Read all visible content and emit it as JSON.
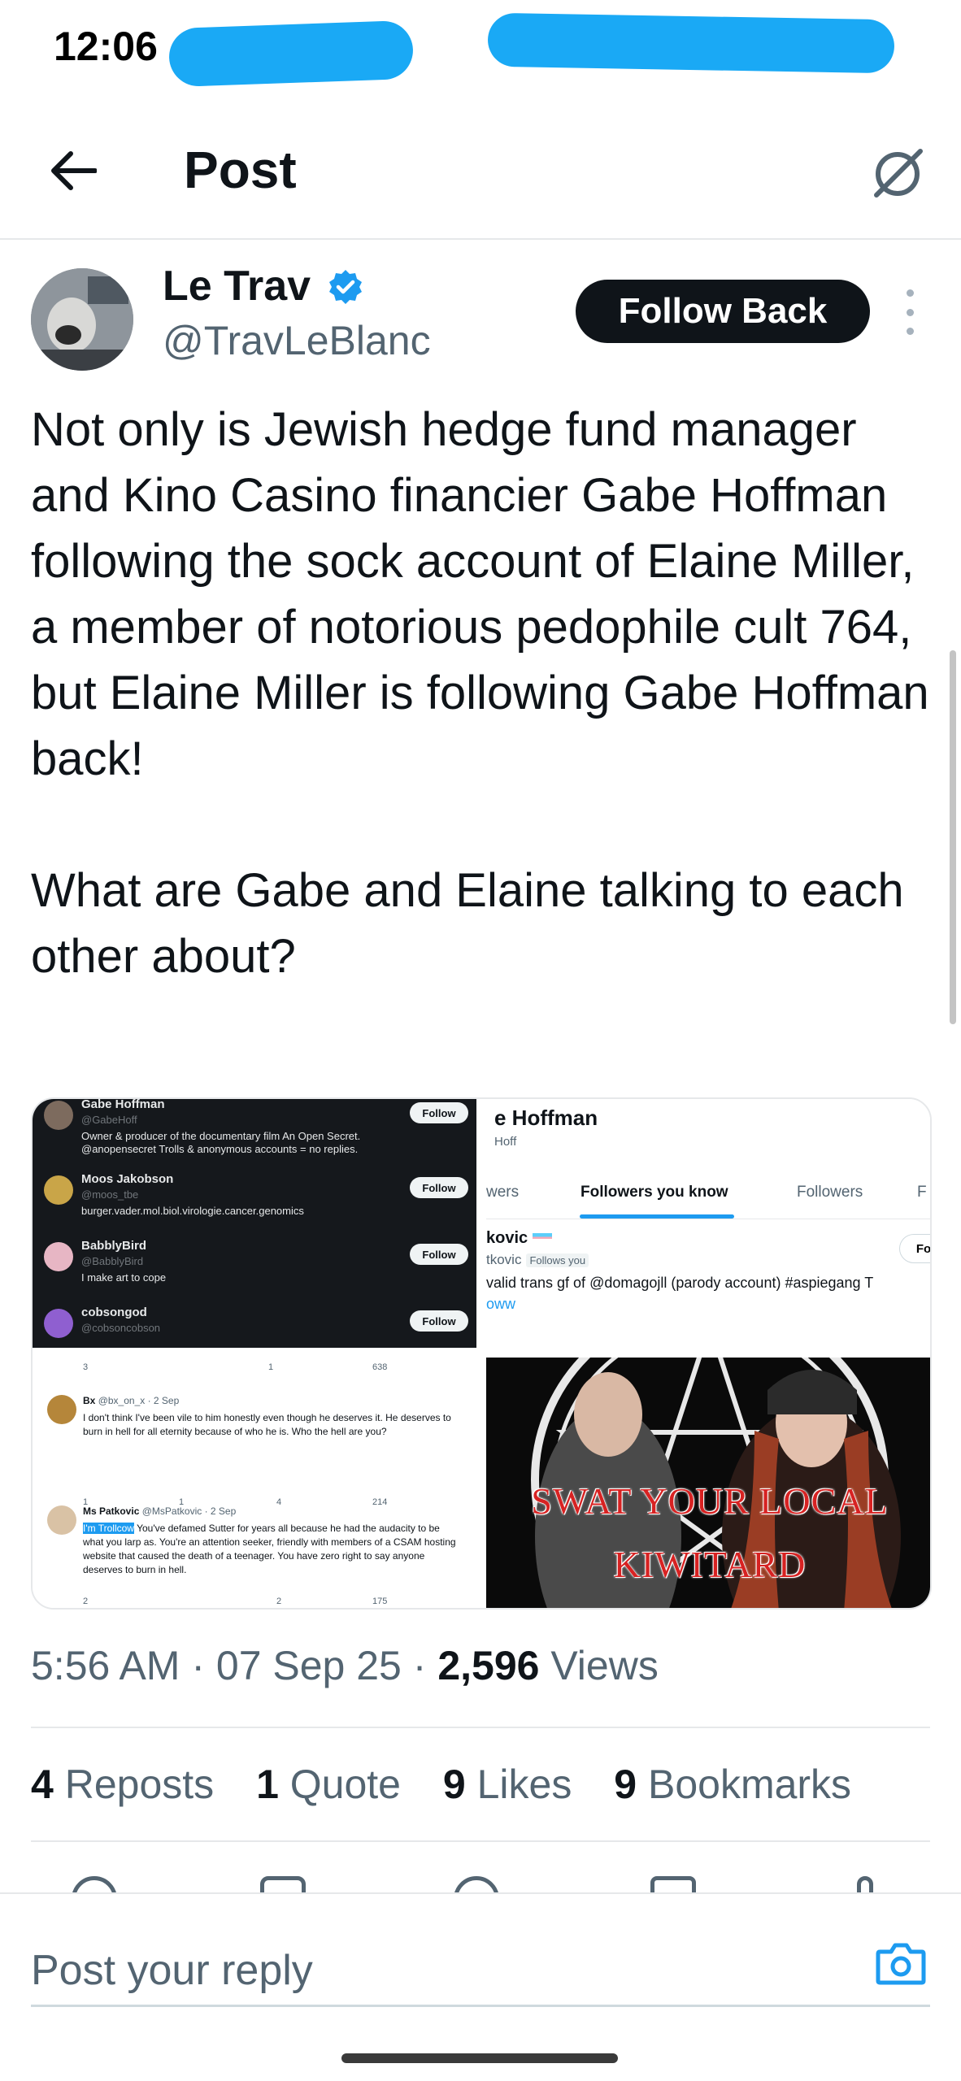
{
  "status_bar": {
    "time": "12:06"
  },
  "header": {
    "title": "Post"
  },
  "post": {
    "author_name": "Le Trav",
    "author_handle": "@TravLeBlanc",
    "follow_label": "Follow Back",
    "text": "Not only is Jewish hedge fund manager and Kino Casino financier Gabe Hoffman following the sock account of Elaine Miller, a member of notorious pedophile cult 764, but Elaine Miller is following Gabe Hoffman back!\n\nWhat are Gabe and Elaine talking to each other about?",
    "media": {
      "tile_a": {
        "users": [
          {
            "name": "Gabe Hoffman",
            "handle": "@GabeHoff",
            "bio": "Owner & producer of the documentary film An Open Secret. @anopensecret Trolls & anonymous accounts = no replies.",
            "follow": "Follow"
          },
          {
            "name": "Moos Jakobson",
            "handle": "@moos_tbe",
            "bio": "burger.vader.mol.biol.virologie.cancer.genomics",
            "follow": "Follow"
          },
          {
            "name": "BabblyBird",
            "handle": "@BabblyBird",
            "bio": "I make art to cope",
            "follow": "Follow"
          },
          {
            "name": "cobsongod",
            "handle": "@cobsoncobson",
            "bio": "",
            "follow": "Follow"
          }
        ]
      },
      "tile_b": {
        "name": "e Hoffman",
        "handle": "Hoff",
        "tabs": [
          "wers",
          "Followers you know",
          "Followers",
          "F"
        ],
        "user_name": "kovic",
        "user_handle": "tkovic",
        "follows_you": "Follows you",
        "bio": "valid trans gf of @domagojll (parody account) #aspiegang T",
        "link": "oww",
        "follow": "Fo"
      },
      "tile_c": {
        "top_stats": [
          "3",
          "1",
          "638"
        ],
        "replies": [
          {
            "name": "Bx",
            "handle": "@bx_on_x · 2 Sep",
            "text": "I don't think I've been vile to him honestly even though he deserves it. He deserves to burn in hell for all eternity because of who he is. Who the hell are you?",
            "stats": [
              "1",
              "1",
              "4",
              "214"
            ]
          },
          {
            "name": "Ms Patkovic",
            "handle": "@MsPatkovic · 2 Sep",
            "highlight": "I'm Trollcow",
            "text": " You've defamed Sutter for years all because he had the audacity to be what you larp as. You're an attention seeker, friendly with members of a CSAM hosting website that caused the death of a teenager. You have zero right to say anyone deserves to burn in hell.",
            "stats": [
              "2",
              "",
              "2",
              "175"
            ]
          }
        ]
      },
      "tile_d": {
        "line1": "SWAT YOUR LOCAL",
        "line2": "KIWITARD"
      }
    },
    "time": "5:56 AM",
    "date": "07 Sep 25",
    "views_count": "2,596",
    "views_label": "Views",
    "stats": {
      "reposts_count": "4",
      "reposts_label": "Reposts",
      "quotes_count": "1",
      "quotes_label": "Quote",
      "likes_count": "9",
      "likes_label": "Likes",
      "bookmarks_count": "9",
      "bookmarks_label": "Bookmarks"
    }
  },
  "composer": {
    "placeholder": "Post your reply"
  },
  "icons": [
    "back-arrow-icon",
    "grok-icon",
    "verified-badge-icon",
    "more-icon",
    "camera-icon"
  ],
  "colors": {
    "accent": "#1d9bf0",
    "text": "#0f1419",
    "secondary": "#536471",
    "follow_button": "#0f1419"
  }
}
